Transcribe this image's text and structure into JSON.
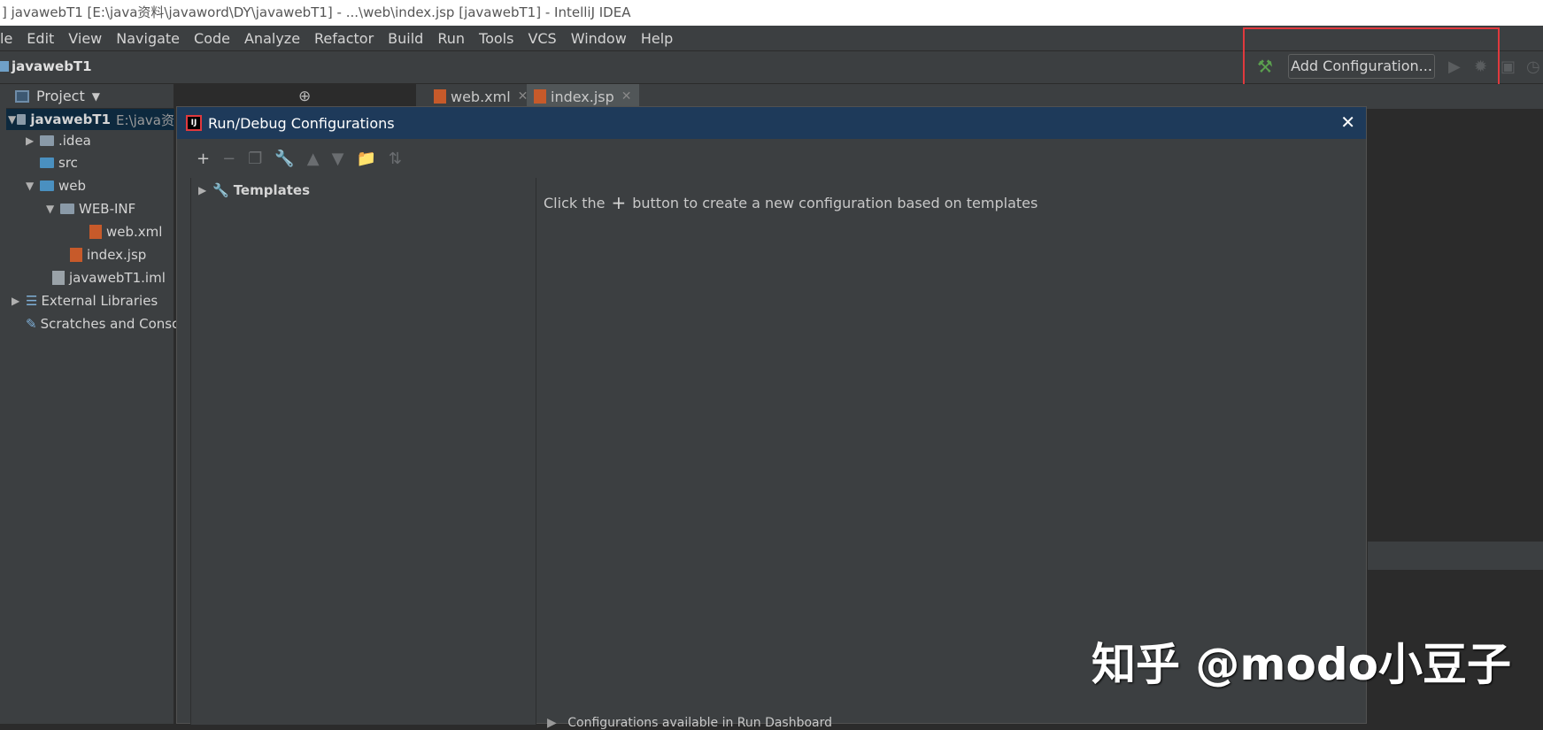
{
  "window": {
    "title": "] javawebT1 [E:\\java资料\\javaword\\DY\\javawebT1] - ...\\web\\index.jsp [javawebT1] - IntelliJ IDEA"
  },
  "menu": [
    "le",
    "Edit",
    "View",
    "Navigate",
    "Code",
    "Analyze",
    "Refactor",
    "Build",
    "Run",
    "Tools",
    "VCS",
    "Window",
    "Help"
  ],
  "nav": {
    "project_name": "javawebT1",
    "add_config_label": "Add Configuration..."
  },
  "project_panel": {
    "title": "Project",
    "tree": [
      {
        "label": "javawebT1",
        "extra": "E:\\java资",
        "icon": "module-folder-icon"
      },
      {
        "label": ".idea",
        "icon": "folder-icon"
      },
      {
        "label": "src",
        "icon": "source-folder-icon"
      },
      {
        "label": "web",
        "icon": "web-folder-icon"
      },
      {
        "label": "WEB-INF",
        "icon": "folder-icon"
      },
      {
        "label": "web.xml",
        "icon": "xml-file-icon"
      },
      {
        "label": "index.jsp",
        "icon": "jsp-file-icon"
      },
      {
        "label": "javawebT1.iml",
        "icon": "iml-file-icon"
      },
      {
        "label": "External Libraries",
        "icon": "libraries-icon"
      },
      {
        "label": "Scratches and Conso",
        "icon": "scratches-icon"
      }
    ]
  },
  "editor_tabs": [
    {
      "label": "web.xml",
      "active": false
    },
    {
      "label": "index.jsp",
      "active": true
    }
  ],
  "dialog": {
    "title": "Run/Debug Configurations",
    "templates_label": "Templates",
    "hint_before": "Click the",
    "hint_after": "button to create a new configuration based on templates",
    "dashboard_label": "Configurations available in Run Dashboard"
  },
  "watermark": "知乎 @modo小豆子",
  "colors": {
    "highlight_box": "#e0393d",
    "dialog_title_bar": "#1e3a5a",
    "panel_bg": "#3c3f41",
    "editor_bg": "#2b2b2b"
  }
}
